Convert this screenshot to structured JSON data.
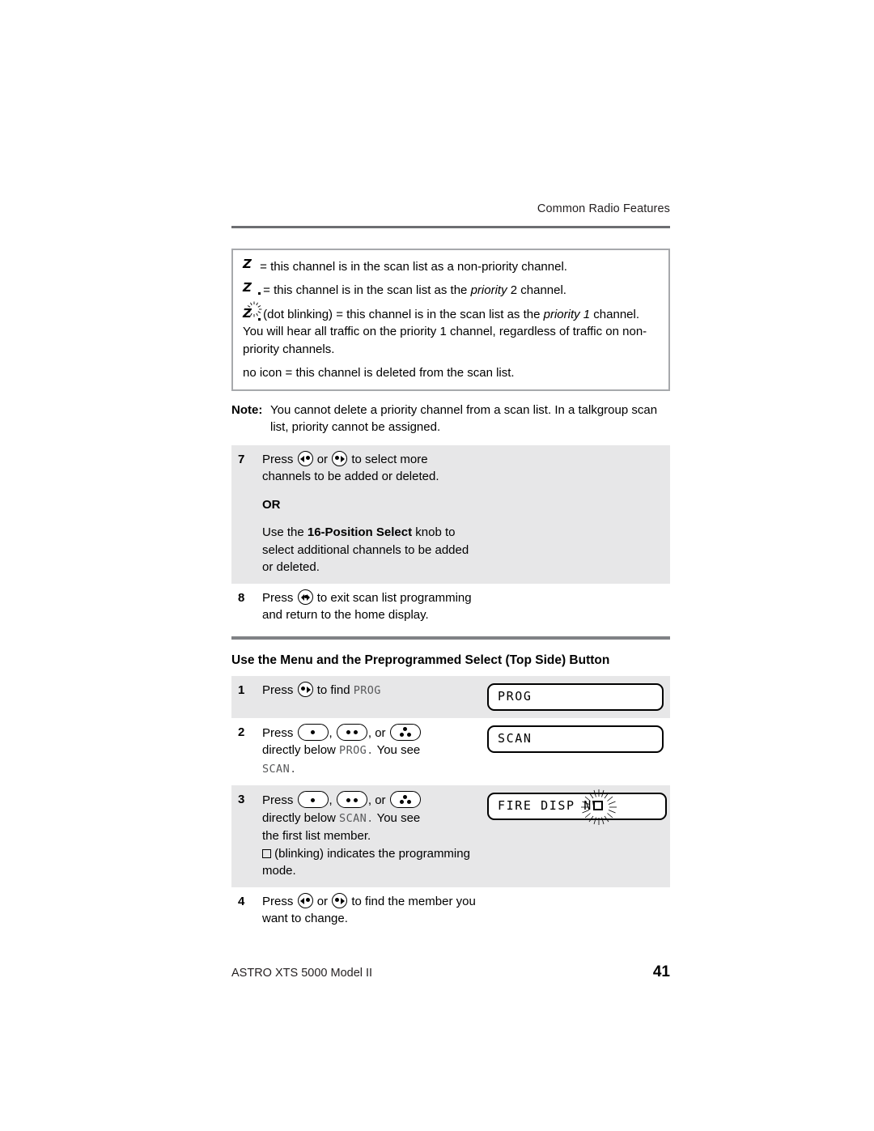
{
  "header": {
    "title": "Common Radio Features"
  },
  "info_box": {
    "lines": [
      {
        "icon": "scan-nonpriority-icon",
        "text_before": " = this channel is in the scan list as a non-priority channel.",
        "italic": "",
        "text_after": ""
      },
      {
        "icon": "scan-priority2-icon",
        "text_before": " = this channel is in the scan list as the ",
        "italic": "priority",
        "text_after": " 2 channel."
      },
      {
        "icon": "scan-priority1-blinking-icon",
        "text_before": " (dot blinking) = this channel is in the scan list as the ",
        "italic": "priority 1",
        "text_after": " channel. You will hear all traffic on the priority 1 channel, regardless of traffic on non-priority channels."
      },
      {
        "icon": "",
        "text_before": "no icon = this channel is deleted from the scan list.",
        "italic": "",
        "text_after": ""
      }
    ]
  },
  "note": {
    "label": "Note:",
    "text": "You cannot delete a priority channel from a scan list. In a talkgroup scan list, priority cannot be assigned."
  },
  "steps_first": [
    {
      "num": "7",
      "press_label": "Press",
      "mid_label": "or",
      "tail": "to select more channels to be added or deleted.",
      "or_label": "OR",
      "alt_prefix": "Use the ",
      "alt_bold": "16-Position Select",
      "alt_suffix": " knob to select additional channels to be added or deleted.",
      "shaded": true
    },
    {
      "num": "8",
      "press_label": "Press",
      "tail": "to exit scan list programming and return to the home display.",
      "shaded": false
    }
  ],
  "section": {
    "heading": "Use the Menu and the Preprogrammed Select (Top Side) Button"
  },
  "steps_second": [
    {
      "num": "1",
      "press_label": "Press",
      "tail_before": "to find ",
      "lcd_ref": "PROG",
      "tail_after": "",
      "display": "PROG",
      "display_blink": false,
      "shaded": true
    },
    {
      "num": "2",
      "press_label": "Press",
      "sep1": ", ",
      "sep2": ", or ",
      "line2_before": "directly below ",
      "line2_lcd": "PROG.",
      "line2_after": " You see",
      "line3_lcd": "SCAN.",
      "display": "SCAN",
      "display_blink": false,
      "shaded": false
    },
    {
      "num": "3",
      "press_label": "Press",
      "sep1": ", ",
      "sep2": ", or ",
      "line2_before": "directly below ",
      "line2_lcd": "SCAN.",
      "line2_after": " You see",
      "line3": "the first list member.",
      "line4_after": " (blinking) indicates the programming mode.",
      "display": "FIRE DISP NW",
      "display_blink": true,
      "shaded": true
    },
    {
      "num": "4",
      "press_label": "Press",
      "mid_label": "or",
      "tail": "to find the member you want to change.",
      "display": "",
      "display_blink": false,
      "shaded": false
    }
  ],
  "footer": {
    "left": "ASTRO XTS 5000 Model II",
    "page": "41"
  },
  "colors": {
    "shade": "#e7e7e8",
    "rule": "#6d6e71",
    "section_rule": "#808285",
    "box_border": "#a7a9ac",
    "lcd_prose": "#58595b"
  }
}
